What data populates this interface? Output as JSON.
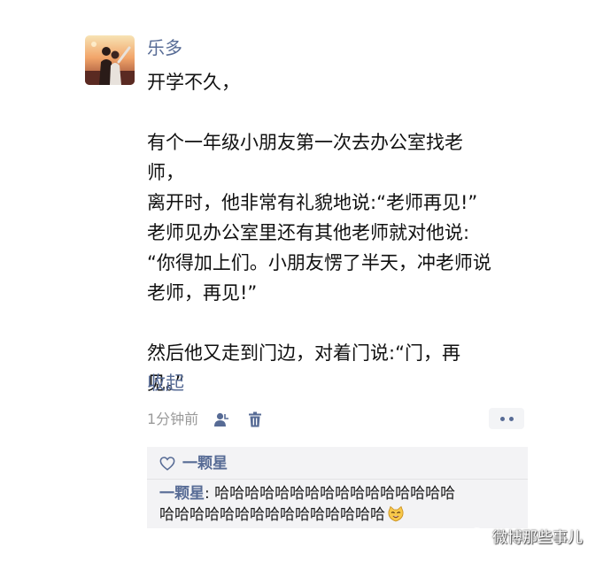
{
  "post": {
    "author": "乐多",
    "content_lines": [
      "开学不久，",
      "",
      "有个一年级小朋友第一次去办公室找老",
      "师，",
      "离开时，他非常有礼貌地说:“老师再见!”",
      "老师见办公室里还有其他老师就对他说:",
      "“你得加上们。小朋友愣了半天，冲老师说",
      "老师，再见!”",
      "",
      "然后他又走到门边，对着门说:“门，再",
      "见。”"
    ],
    "collapse_label": "收起",
    "timestamp": "1分钟前"
  },
  "icons": {
    "visibility": "person-icon",
    "delete": "trash-icon",
    "more": "more-dots-icon",
    "like": "heart-icon",
    "emoji": "cat-emoji"
  },
  "likes": {
    "names": "一颗星"
  },
  "comment": {
    "commenter": "一颗星",
    "separator": ": ",
    "line1_text": "哈哈哈哈哈哈哈哈哈哈哈哈哈哈哈哈",
    "line2_text": "哈哈哈哈哈哈哈哈哈哈哈哈哈哈哈"
  },
  "watermark": {
    "text": "微博那些事儿"
  },
  "colors": {
    "link": "#576b95",
    "timestamp": "#9a9a9a",
    "comment_bg": "#f3f3f5"
  }
}
